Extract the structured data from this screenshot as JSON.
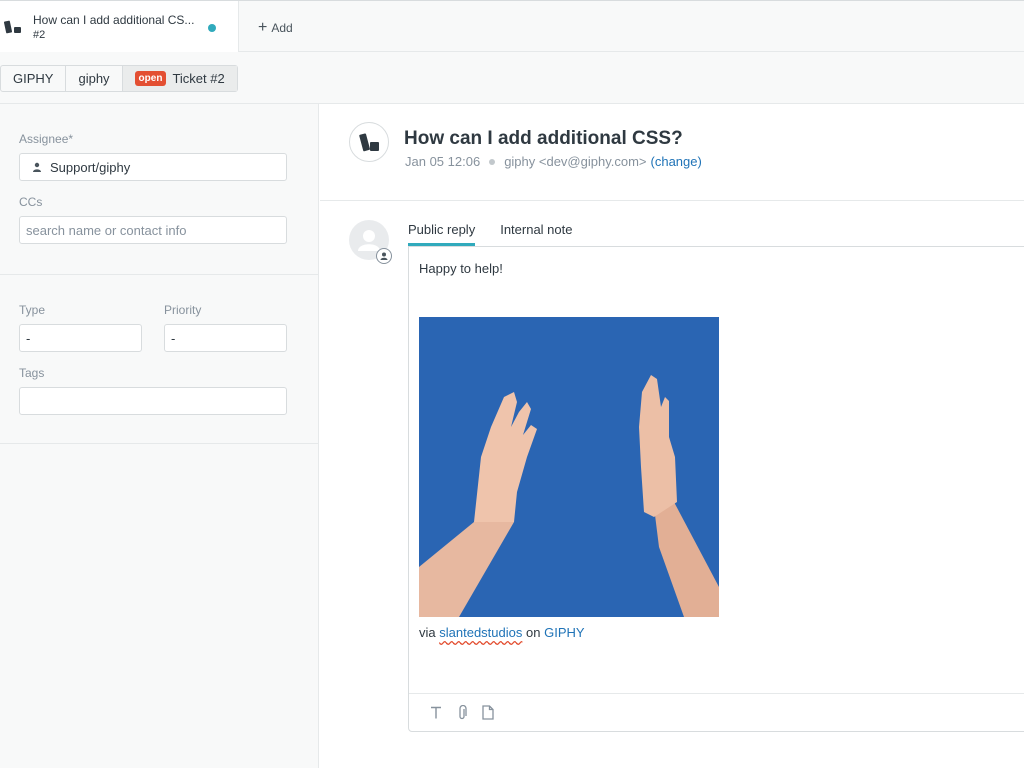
{
  "tabbar": {
    "ticket_tab": {
      "title": "How can I add additional CS...",
      "subtitle": "#2",
      "unread": true
    },
    "add_label": "Add"
  },
  "breadcrumb": {
    "items": [
      "GIPHY",
      "giphy"
    ],
    "status_badge": "open",
    "ticket_label": "Ticket #2"
  },
  "sidebar": {
    "assignee_label": "Assignee*",
    "assignee_value": "Support/giphy",
    "ccs_label": "CCs",
    "ccs_placeholder": "search name or contact info",
    "type_label": "Type",
    "type_value": "-",
    "priority_label": "Priority",
    "priority_value": "-",
    "tags_label": "Tags",
    "tags_value": ""
  },
  "ticket": {
    "title": "How can I add additional CSS?",
    "date": "Jan 05 12:06",
    "requester": "giphy <dev@giphy.com>",
    "change_label": "(change)"
  },
  "reply": {
    "tabs": [
      "Public reply",
      "Internal note"
    ],
    "active_tab": "Public reply",
    "body_text": "Happy to help!",
    "attribution_via": "via",
    "attribution_author": "slantedstudios",
    "attribution_on": "on",
    "attribution_source": "GIPHY",
    "toolbar_icons": [
      "text-format-icon",
      "attachment-icon",
      "document-icon"
    ]
  },
  "colors": {
    "accent": "#30aabc",
    "link": "#1f73b7",
    "open_badge": "#e34f32",
    "gif_background": "#2a65b3"
  }
}
